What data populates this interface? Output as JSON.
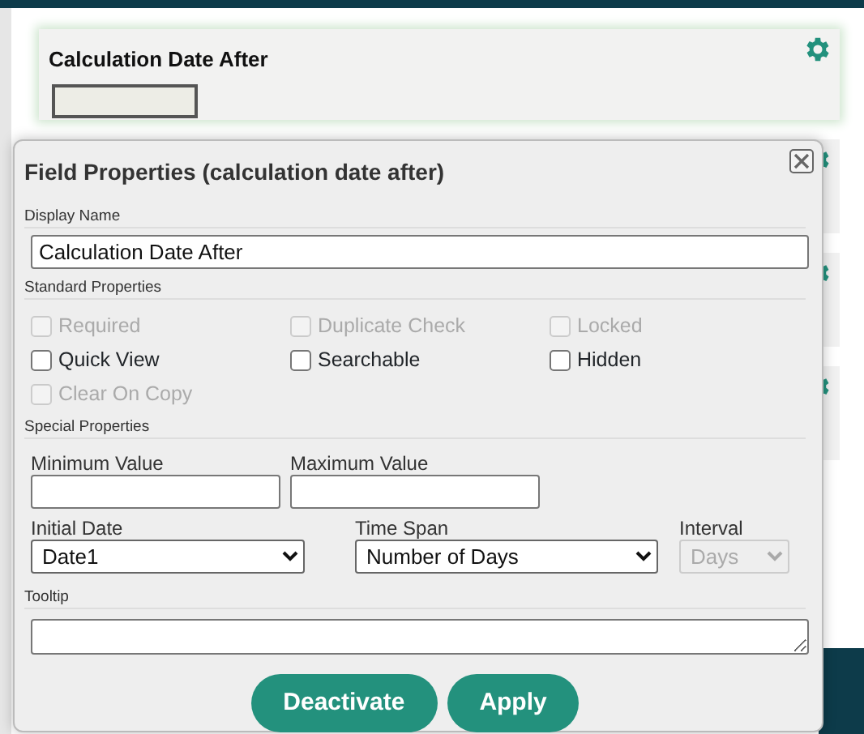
{
  "card": {
    "title": "Calculation Date After"
  },
  "dialog": {
    "title": "Field Properties (calculation date after)",
    "display_name": {
      "label": "Display Name",
      "value": "Calculation Date After"
    },
    "standard": {
      "label": "Standard Properties",
      "checkboxes": [
        {
          "label": "Required",
          "checked": false,
          "disabled": true
        },
        {
          "label": "Duplicate Check",
          "checked": false,
          "disabled": true
        },
        {
          "label": "Locked",
          "checked": false,
          "disabled": true
        },
        {
          "label": "Quick View",
          "checked": false,
          "disabled": false
        },
        {
          "label": "Searchable",
          "checked": false,
          "disabled": false
        },
        {
          "label": "Hidden",
          "checked": false,
          "disabled": false
        },
        {
          "label": "Clear On Copy",
          "checked": false,
          "disabled": true
        }
      ]
    },
    "special": {
      "label": "Special Properties",
      "rows": [
        [
          {
            "kind": "input",
            "label": "Minimum Value"
          },
          {
            "kind": "input",
            "label": "Maximum Value"
          }
        ],
        [
          {
            "kind": "select",
            "label": "Initial Date",
            "value": "Date1",
            "disabled": false
          },
          {
            "kind": "select",
            "label": "Time Span",
            "value": "Number of Days",
            "disabled": false
          },
          {
            "kind": "select",
            "label": "Interval",
            "value": "Days",
            "disabled": true
          }
        ]
      ]
    },
    "tooltip": {
      "label": "Tooltip"
    },
    "buttons": [
      "Deactivate",
      "Apply"
    ]
  }
}
